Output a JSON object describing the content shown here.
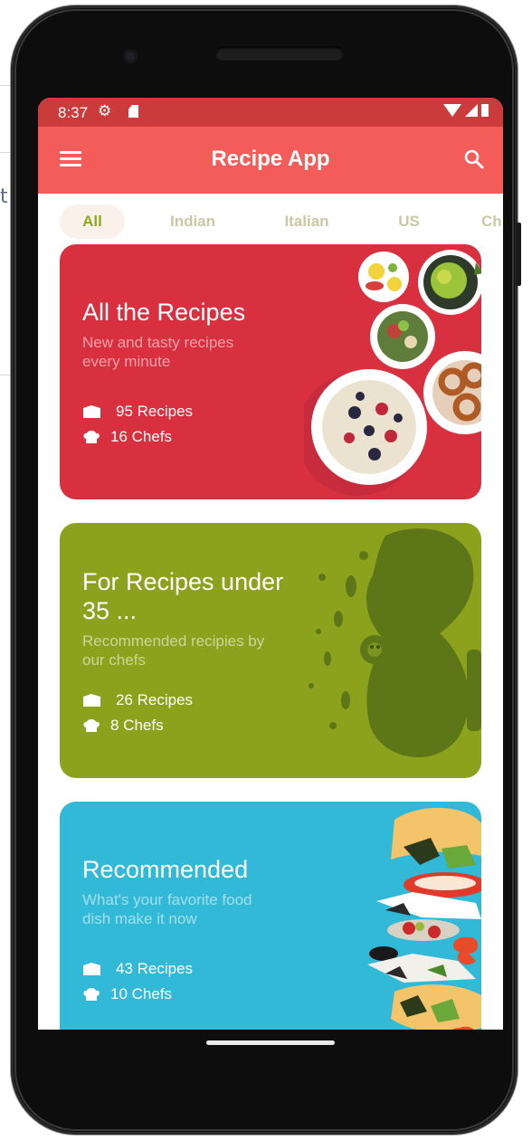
{
  "status_bar": {
    "time": "8:37"
  },
  "app_bar": {
    "title": "Recipe App"
  },
  "tabs": [
    {
      "label": "All",
      "active": true
    },
    {
      "label": "Indian",
      "active": false
    },
    {
      "label": "Italian",
      "active": false
    },
    {
      "label": "US",
      "active": false
    },
    {
      "label": "Ch",
      "active": false
    }
  ],
  "cards": [
    {
      "title": "All the Recipes",
      "subtitle": "New and tasty recipes every minute",
      "recipes": "95 Recipes",
      "chefs": "16 Chefs",
      "color": "#d9303f"
    },
    {
      "title": "For Recipes under 35 ...",
      "subtitle": "Recommended recipies by our chefs",
      "recipes": "26 Recipes",
      "chefs": "8 Chefs",
      "color": "#8ca21d"
    },
    {
      "title": "Recommended",
      "subtitle": "What's your favorite food dish make it now",
      "recipes": "43 Recipes",
      "chefs": "10 Chefs",
      "color": "#32b9d7"
    }
  ],
  "colors": {
    "status_bar": "#cc3b3b",
    "app_bar": "#f45c5a",
    "tab_active": "#8aab20",
    "tab_inactive": "#c8c8a4"
  },
  "icons": [
    "menu-icon",
    "search-icon",
    "settings-icon",
    "sd-card-icon",
    "wifi-icon",
    "signal-icon",
    "battery-icon",
    "recipe-book-icon",
    "chef-hat-icon"
  ]
}
